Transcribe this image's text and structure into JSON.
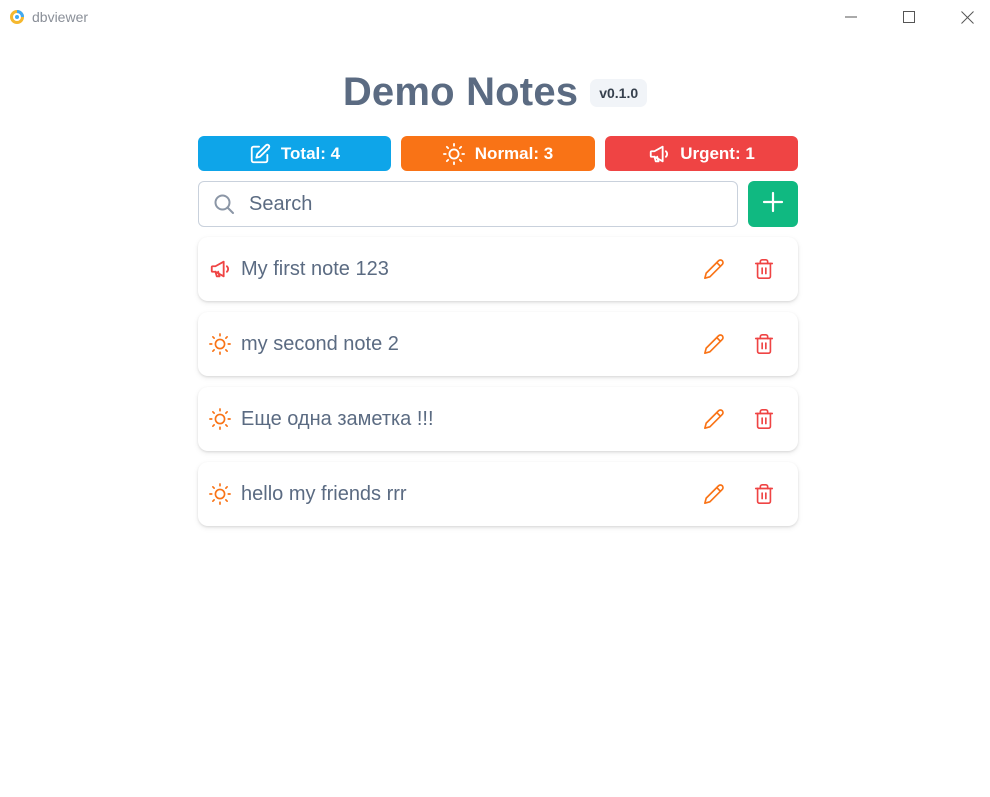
{
  "window": {
    "title": "dbviewer",
    "app_icon": "app-logo-icon",
    "controls": [
      "minimize-icon",
      "maximize-icon",
      "close-icon"
    ]
  },
  "header": {
    "title": "Demo Notes",
    "version": "v0.1.0"
  },
  "stats": {
    "total": {
      "label": "Total: 4",
      "icon": "edit-square-icon",
      "color": "#0ea5e9"
    },
    "normal": {
      "label": "Normal: 3",
      "icon": "sun-icon",
      "color": "#f97316"
    },
    "urgent": {
      "label": "Urgent: 1",
      "icon": "megaphone-icon",
      "color": "#ef4444"
    }
  },
  "search": {
    "placeholder": "Search",
    "value": ""
  },
  "add_button": {
    "icon": "plus-icon",
    "color": "#10b981"
  },
  "notes": [
    {
      "text": "My first note 123",
      "priority": "urgent",
      "icon": "megaphone-icon"
    },
    {
      "text": "my second note 2",
      "priority": "normal",
      "icon": "sun-icon"
    },
    {
      "text": "Еще одна заметка !!!",
      "priority": "normal",
      "icon": "sun-icon"
    },
    {
      "text": "hello my friends rrr",
      "priority": "normal",
      "icon": "sun-icon"
    }
  ],
  "colors": {
    "text": "#5b6b82",
    "edit": "#f97316",
    "delete": "#ef4444",
    "normal": "#f97316",
    "urgent": "#ef4444"
  }
}
